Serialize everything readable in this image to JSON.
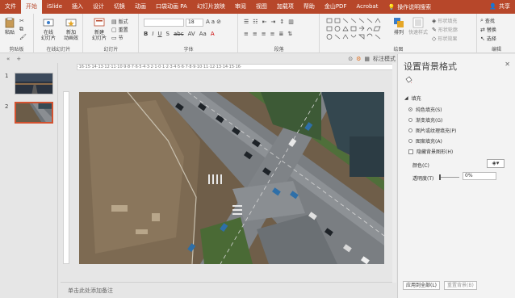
{
  "tabs": [
    "文件",
    "开始",
    "iSlide",
    "插入",
    "设计",
    "切换",
    "动画",
    "口袋动画 PA",
    "幻灯片放映",
    "审阅",
    "视图",
    "加载项",
    "帮助",
    "金山PDF",
    "Acrobat"
  ],
  "active_tab": "开始",
  "tell_me": "操作说明搜索",
  "share": "共享",
  "ribbon": {
    "clipboard": {
      "paste": "粘贴",
      "label": "剪贴板"
    },
    "slides_group": {
      "online": "在线\n幻灯片",
      "add": "新加\n动画效",
      "new_slide": "新建\n幻灯片",
      "layout": "版式",
      "reset": "重置",
      "section": "节",
      "label": "幻灯片",
      "online_label": "在线幻灯片"
    },
    "font": {
      "size": "18",
      "label": "字体"
    },
    "paragraph": {
      "label": "段落"
    },
    "drawing": {
      "arrange": "排列",
      "quick_styles": "快速样式",
      "fill": "形状填充",
      "outline": "形状轮廓",
      "effects": "形状效果",
      "label": "绘图"
    },
    "editing": {
      "find": "查找",
      "replace": "替换",
      "select": "选择",
      "label": "编辑"
    }
  },
  "format_bar": {
    "label": "标注模式"
  },
  "slides": [
    {
      "num": "1"
    },
    {
      "num": "2"
    }
  ],
  "ruler_text": "·16·15·14·13·12·11·10·9·8·7·6·5·4·3·2·1·0·1·2·3·4·5·6·7·8·9·10·11·12·13·14·15·16·",
  "notes_placeholder": "单击此处添加备注",
  "pane": {
    "title": "设置背景格式",
    "section": "填充",
    "options": [
      {
        "label": "纯色填充(S)",
        "selected": true
      },
      {
        "label": "渐变填充(G)",
        "selected": false
      },
      {
        "label": "图片或纹理填充(P)",
        "selected": false
      },
      {
        "label": "图案填充(A)",
        "selected": false
      }
    ],
    "hide_bg": "隐藏背景图形(H)",
    "color_label": "颜色(C)",
    "transparency_label": "透明度(T)",
    "transparency_value": "0%",
    "apply_all": "应用到全部(L)",
    "reset_bg": "重置背景(B)"
  },
  "colors": {
    "accent": "#b7472a",
    "selected_border": "#d35230"
  }
}
